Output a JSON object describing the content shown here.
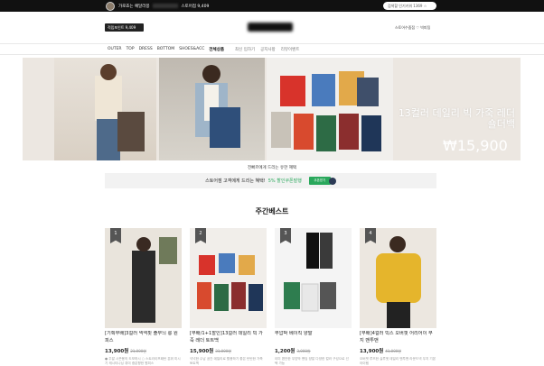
{
  "topbar": {
    "greeting_prefix": "가로죠는 예달라몽",
    "greeting_suffix": "스토어점 9,409",
    "search_placeholder": "검색할 인기키워 1369 ☆"
  },
  "header": {
    "points_label": "적립포인트 9,409",
    "right_links": "스토어수줌점 ♡ 빅피팅"
  },
  "menu": {
    "categories": [
      "OUTER",
      "TOP",
      "DRESS",
      "BOTTOM",
      "SHOES&ACC",
      "전체상품"
    ],
    "sublinks": [
      "최신 입하기",
      "공지사항",
      "리뷰이벤트"
    ]
  },
  "banner": {
    "text": "13컬러 데일리 빅 가죽 레더 숄더백",
    "price": "₩15,900"
  },
  "caption": "전빠르에게 드리는 유한 혜택",
  "coupon": {
    "text": "스토어점 고객에게 드리는 혜택!",
    "percent": "5% 할인쿠폰발행",
    "button": "쿠폰받기"
  },
  "section_title": "주간베스트",
  "products": [
    {
      "rank": "1",
      "name": "[기획무배]3컬러 넥넥핏 출무늬 롱 원피스",
      "price": "13,900원",
      "original": "21,000원",
      "desc": "● 주말 시즌용의 도보하시 ○ 스트라이프패턴 분위 미시기 캐시티나닝 취미 중분향한 원피스"
    },
    {
      "rank": "2",
      "name": "[무배/1+1할인]13컬러 데일리 빅 가죽 레더 토트백",
      "price": "15,900원",
      "original": "31,000원",
      "desc": "넉넉한 수납 공간 데일리로 활용하기 좋은 탄탄한 가죽 토트백"
    },
    {
      "rank": "3",
      "name": "무압박 베이직 양말",
      "price": "1,200원",
      "original": "3,000원",
      "desc": "이미 편안한 무압박 밴딩 양말 다양한 컬러 구성으로 선택 가능"
    },
    {
      "rank": "4",
      "name": "[무배]4컬러 빅스 오버핏 어리어이 무지 맨투맨",
      "price": "13,900원",
      "original": "41,000원",
      "desc": "오버핏 루즈한 실루엣 데일리 맨투맨 라운드넥 무지 기본 아이템"
    }
  ],
  "colors": {
    "accent_green": "#2aa85c",
    "topbar_bg": "#111111"
  }
}
